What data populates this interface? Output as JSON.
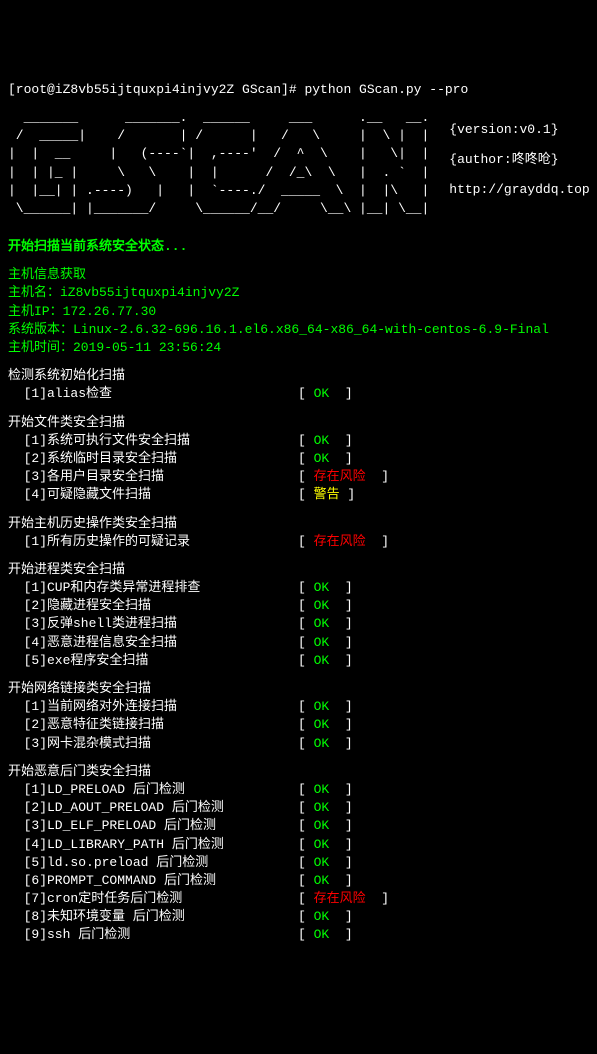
{
  "prompt": "[root@iZ8vb55ijtquxpi4injvy2Z GScan]# python GScan.py --pro",
  "banner": {
    "version": "{version:v0.1}",
    "author": "{author:咚咚呛}",
    "url": "http://grayddq.top"
  },
  "ascii": [
    "  _______      _______.  ______     ___      .__   __.",
    " /  _____|    /       | /      |   /   \\     |  \\ |  |",
    "|  |  __     |   (----`|  ,----'  /  ^  \\    |   \\|  |",
    "|  | |_ |     \\   \\    |  |      /  /_\\  \\   |  . `  |",
    "|  |__| | .----)   |   |  `----./  _____  \\  |  |\\   |",
    " \\______| |_______/     \\______/__/     \\__\\ |__| \\__|"
  ],
  "scan_start": "开始扫描当前系统安全状态...",
  "host_info": {
    "title": "主机信息获取",
    "hostname_label": "主机名：",
    "hostname": "iZ8vb55ijtquxpi4injvy2Z",
    "ip_label": "主机IP：",
    "ip": "172.26.77.30",
    "version_label": "系统版本：",
    "version": "Linux-2.6.32-696.16.1.el6.x86_64-x86_64-with-centos-6.9-Final",
    "time_label": "主机时间：",
    "time": "2019-05-11 23:56:24"
  },
  "sections": [
    {
      "title": "检测系统初始化扫描",
      "items": [
        {
          "label": "  [1]alias检查",
          "status": "OK",
          "type": "ok"
        }
      ]
    },
    {
      "title": "开始文件类安全扫描",
      "items": [
        {
          "label": "  [1]系统可执行文件安全扫描",
          "status": "OK",
          "type": "ok"
        },
        {
          "label": "  [2]系统临时目录安全扫描",
          "status": "OK",
          "type": "ok"
        },
        {
          "label": "  [3]各用户目录安全扫描",
          "status": "存在风险",
          "type": "risk"
        },
        {
          "label": "  [4]可疑隐藏文件扫描",
          "status": "警告",
          "type": "warn"
        }
      ]
    },
    {
      "title": "开始主机历史操作类安全扫描",
      "items": [
        {
          "label": "  [1]所有历史操作的可疑记录",
          "status": "存在风险",
          "type": "risk"
        }
      ]
    },
    {
      "title": "开始进程类安全扫描",
      "items": [
        {
          "label": "  [1]CUP和内存类异常进程排查",
          "status": "OK",
          "type": "ok"
        },
        {
          "label": "  [2]隐藏进程安全扫描",
          "status": "OK",
          "type": "ok"
        },
        {
          "label": "  [3]反弹shell类进程扫描",
          "status": "OK",
          "type": "ok"
        },
        {
          "label": "  [4]恶意进程信息安全扫描",
          "status": "OK",
          "type": "ok"
        },
        {
          "label": "  [5]exe程序安全扫描",
          "status": "OK",
          "type": "ok"
        }
      ]
    },
    {
      "title": "开始网络链接类安全扫描",
      "items": [
        {
          "label": "  [1]当前网络对外连接扫描",
          "status": "OK",
          "type": "ok"
        },
        {
          "label": "  [2]恶意特征类链接扫描",
          "status": "OK",
          "type": "ok"
        },
        {
          "label": "  [3]网卡混杂模式扫描",
          "status": "OK",
          "type": "ok"
        }
      ]
    },
    {
      "title": "开始恶意后门类安全扫描",
      "items": [
        {
          "label": "  [1]LD_PRELOAD 后门检测",
          "status": "OK",
          "type": "ok"
        },
        {
          "label": "  [2]LD_AOUT_PRELOAD 后门检测",
          "status": "OK",
          "type": "ok"
        },
        {
          "label": "  [3]LD_ELF_PRELOAD 后门检测",
          "status": "OK",
          "type": "ok"
        },
        {
          "label": "  [4]LD_LIBRARY_PATH 后门检测",
          "status": "OK",
          "type": "ok"
        },
        {
          "label": "  [5]ld.so.preload 后门检测",
          "status": "OK",
          "type": "ok"
        },
        {
          "label": "  [6]PROMPT_COMMAND 后门检测",
          "status": "OK",
          "type": "ok"
        },
        {
          "label": "  [7]cron定时任务后门检测",
          "status": "存在风险",
          "type": "risk"
        },
        {
          "label": "  [8]未知环境变量 后门检测",
          "status": "OK",
          "type": "ok"
        },
        {
          "label": "  [9]ssh 后门检测",
          "status": "OK",
          "type": "ok"
        }
      ]
    }
  ],
  "status_text": {
    "ok": "OK",
    "risk": "存在风险",
    "warn": "警告"
  }
}
